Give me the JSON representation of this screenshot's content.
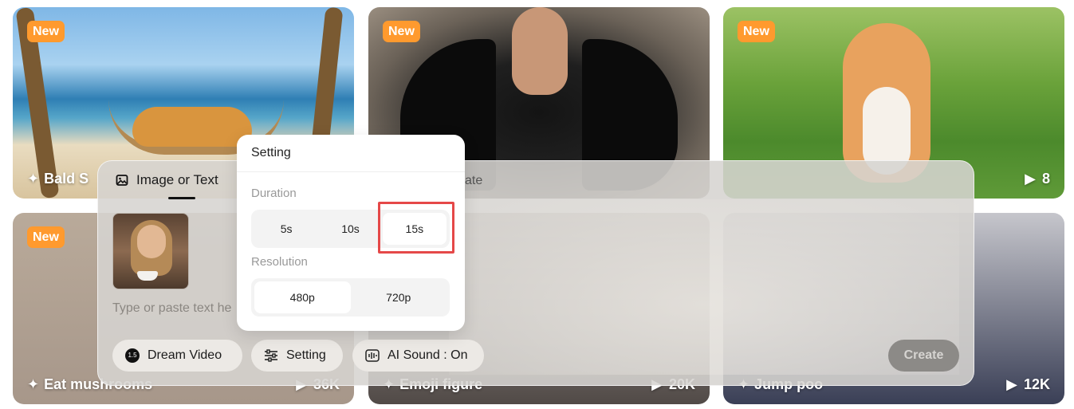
{
  "cards": [
    {
      "badge": "New",
      "title": "Bald S",
      "plays": ""
    },
    {
      "badge": "New",
      "title": "",
      "plays": ""
    },
    {
      "badge": "New",
      "title": "",
      "plays": "8"
    },
    {
      "badge": "New",
      "title": "Eat mushrooms",
      "plays": "36K"
    },
    {
      "badge": "",
      "title": "Emoji figure",
      "plays": "20K"
    },
    {
      "badge": "",
      "title": "Jump poo",
      "plays": "12K"
    }
  ],
  "composer": {
    "tab_image_label": "Image or Text",
    "tab_template_label": "ate",
    "prompt_placeholder": "Type or paste text he",
    "model_badge": "1.5",
    "dream_label": "Dream Video",
    "setting_label": "Setting",
    "sound_label": "AI Sound : On",
    "create_label": "Create"
  },
  "popover": {
    "title": "Setting",
    "duration_label": "Duration",
    "duration_options": [
      "5s",
      "10s",
      "15s"
    ],
    "duration_selected": "15s",
    "resolution_label": "Resolution",
    "resolution_options": [
      "480p",
      "720p"
    ],
    "resolution_selected": "480p"
  },
  "colors": {
    "badge": "#ff9a2e",
    "highlight": "#e54848",
    "create_disabled": "#8c8a87"
  },
  "icons": [
    "sparkle-icon",
    "play-icon",
    "image-icon",
    "sliders-icon",
    "sound-wave-icon"
  ]
}
